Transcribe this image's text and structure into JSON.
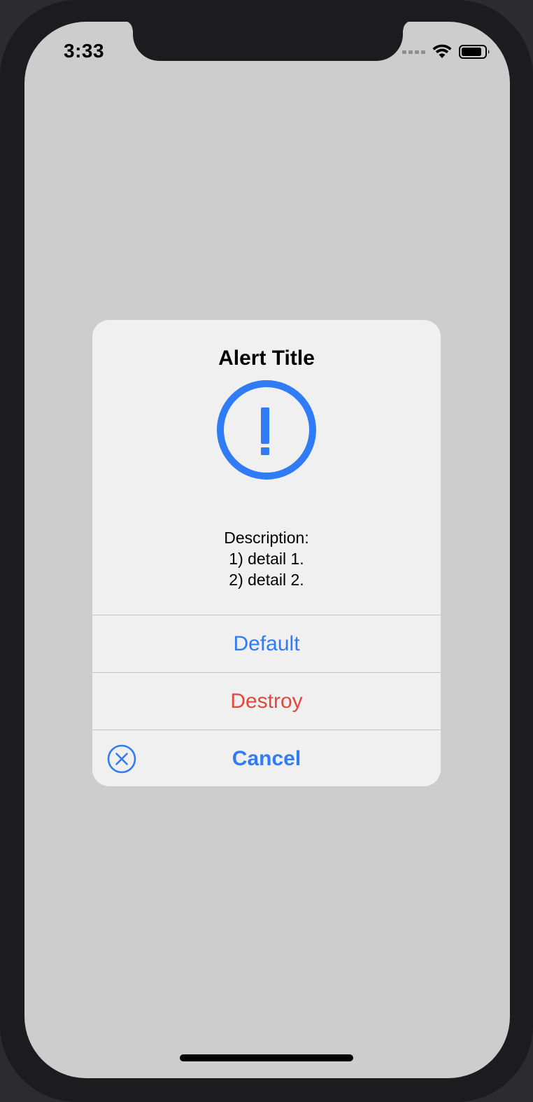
{
  "status_bar": {
    "time": "3:33"
  },
  "alert": {
    "title": "Alert Title",
    "icon": "exclamation-circle-icon",
    "message_lines": [
      "Description:",
      "1) detail 1.",
      "2) detail 2."
    ],
    "actions": {
      "default_label": "Default",
      "destroy_label": "Destroy",
      "cancel_label": "Cancel"
    }
  },
  "colors": {
    "accent": "#2f7cf6",
    "destructive": "#e2483d",
    "alert_background": "#f0f0f0",
    "screen_background": "#cdcdcd"
  }
}
